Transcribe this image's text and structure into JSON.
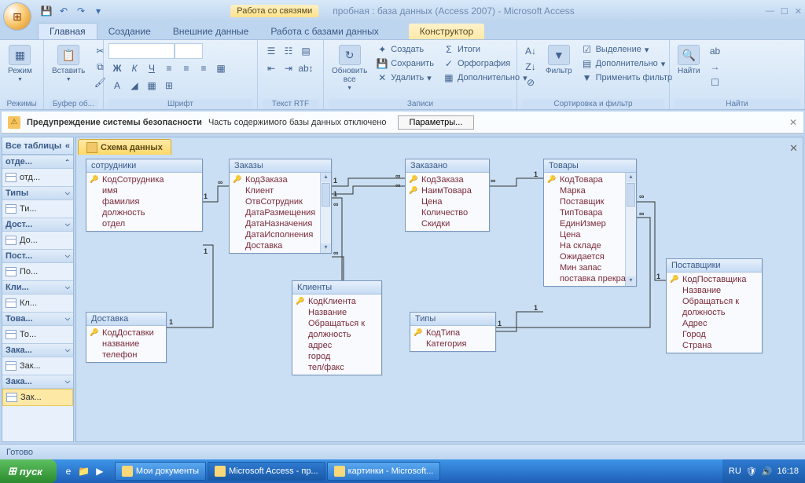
{
  "title": {
    "context_tab": "Работа со связями",
    "app": "пробная : база данных (Access 2007) - Microsoft Access"
  },
  "qat": {
    "save": "💾",
    "undo": "↶",
    "redo": "↷",
    "more": "▾"
  },
  "tabs": {
    "home": "Главная",
    "create": "Создание",
    "external": "Внешние данные",
    "dbtools": "Работа с базами данных",
    "designer": "Конструктор"
  },
  "ribbon": {
    "view": "Режим",
    "paste": "Вставить",
    "refresh_all": "Обновить\nвсе",
    "new": "Создать",
    "save_rec": "Сохранить",
    "delete": "Удалить",
    "totals": "Итоги",
    "spelling": "Орфография",
    "more": "Дополнительно",
    "filter": "Фильтр",
    "selection": "Выделение",
    "advanced": "Дополнительно",
    "toggle_filter": "Применить фильтр",
    "find": "Найти",
    "g_views": "Режимы",
    "g_clipboard": "Буфер об...",
    "g_font": "Шрифт",
    "g_rtf": "Текст RTF",
    "g_records": "Записи",
    "g_sortfilter": "Сортировка и фильтр",
    "g_find": "Найти"
  },
  "security": {
    "title": "Предупреждение системы безопасности",
    "msg": "Часть содержимого базы данных отключено",
    "btn": "Параметры..."
  },
  "nav": {
    "header": "Все таблицы",
    "groups": [
      {
        "h": "отде...",
        "items": [
          "отд..."
        ]
      },
      {
        "h": "Типы",
        "items": [
          "Ти..."
        ]
      },
      {
        "h": "Дост...",
        "items": [
          "До..."
        ]
      },
      {
        "h": "Пост...",
        "items": [
          "По..."
        ]
      },
      {
        "h": "Кли...",
        "items": [
          "Кл..."
        ]
      },
      {
        "h": "Това...",
        "items": [
          "То..."
        ]
      },
      {
        "h": "Зака...",
        "items": [
          "Зак..."
        ]
      },
      {
        "h": "Зака...",
        "items": [
          "Зак..."
        ]
      }
    ]
  },
  "doc_tab": "Схема данных",
  "entities": {
    "sotrudniki": {
      "title": "сотрудники",
      "fields": [
        [
          "КодСотрудника",
          1
        ],
        [
          "имя",
          0
        ],
        [
          "фамилия",
          0
        ],
        [
          "должность",
          0
        ],
        [
          "отдел",
          0
        ]
      ]
    },
    "zakazy": {
      "title": "Заказы",
      "fields": [
        [
          "КодЗаказа",
          1
        ],
        [
          "Клиент",
          0
        ],
        [
          "ОтвСотрудник",
          0
        ],
        [
          "ДатаРазмещения",
          0
        ],
        [
          "ДатаНазначения",
          0
        ],
        [
          "ДатаИсполнения",
          0
        ],
        [
          "Доставка",
          0
        ]
      ]
    },
    "zakazano": {
      "title": "Заказано",
      "fields": [
        [
          "КодЗаказа",
          1
        ],
        [
          "НаимТовара",
          1
        ],
        [
          "Цена",
          0
        ],
        [
          "Количество",
          0
        ],
        [
          "Скидки",
          0
        ]
      ]
    },
    "tovary": {
      "title": "Товары",
      "fields": [
        [
          "КодТовара",
          1
        ],
        [
          "Марка",
          0
        ],
        [
          "Поставщик",
          0
        ],
        [
          "ТипТовара",
          0
        ],
        [
          "ЕдинИзмер",
          0
        ],
        [
          "Цена",
          0
        ],
        [
          "На складе",
          0
        ],
        [
          "Ожидается",
          0
        ],
        [
          "Мин запас",
          0
        ],
        [
          "поставка прекра",
          0
        ]
      ]
    },
    "postavshiki": {
      "title": "Поставщики",
      "fields": [
        [
          "КодПоставщика",
          1
        ],
        [
          "Название",
          0
        ],
        [
          "Обращаться к",
          0
        ],
        [
          "должность",
          0
        ],
        [
          "Адрес",
          0
        ],
        [
          "Город",
          0
        ],
        [
          "Страна",
          0
        ]
      ]
    },
    "dostavka": {
      "title": "Доставка",
      "fields": [
        [
          "КодДоставки",
          1
        ],
        [
          "название",
          0
        ],
        [
          "телефон",
          0
        ]
      ]
    },
    "klienty": {
      "title": "Клиенты",
      "fields": [
        [
          "КодКлиента",
          1
        ],
        [
          "Название",
          0
        ],
        [
          "Обращаться к",
          0
        ],
        [
          "должность",
          0
        ],
        [
          "адрес",
          0
        ],
        [
          "город",
          0
        ],
        [
          "тел/факс",
          0
        ]
      ]
    },
    "tipy": {
      "title": "Типы",
      "fields": [
        [
          "КодТипа",
          1
        ],
        [
          "Категория",
          0
        ]
      ]
    }
  },
  "status": "Готово",
  "taskbar": {
    "start": "пуск",
    "items": [
      "Мои документы",
      "Microsoft Access - пр...",
      "картинки - Microsoft..."
    ],
    "lang": "RU",
    "time": "16:18"
  }
}
